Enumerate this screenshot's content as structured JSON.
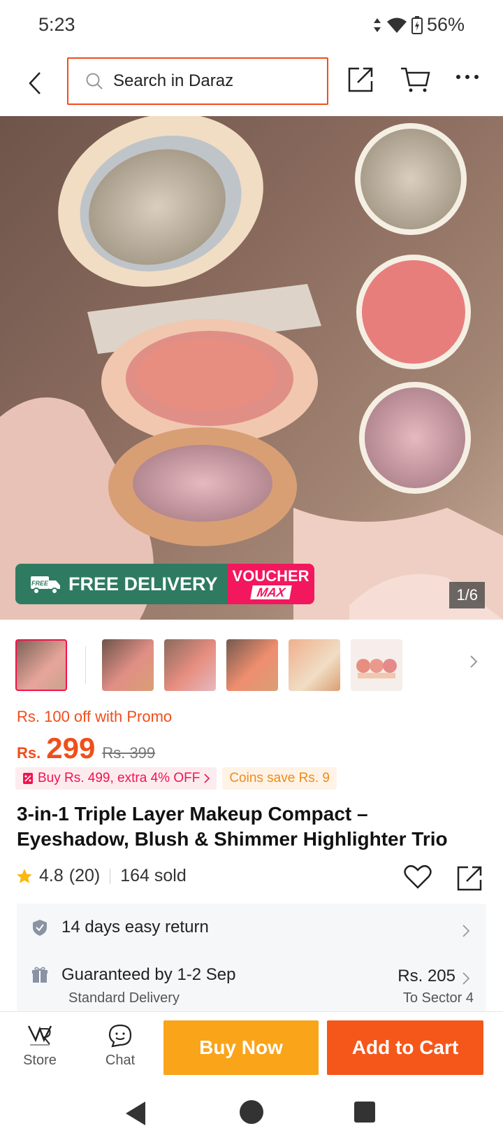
{
  "status": {
    "time": "5:23",
    "battery": "56%"
  },
  "search": {
    "placeholder": "Search in Daraz"
  },
  "hero": {
    "banner_free": "FREE DELIVERY",
    "banner_free_tag": "FREE",
    "banner_voucher": "VOUCHER",
    "banner_max": "MAX",
    "counter": "1/6"
  },
  "product": {
    "promo": "Rs. 100 off with Promo",
    "currency": "Rs.",
    "price": "299",
    "old_price": "Rs. 399",
    "chip_extra": "Buy Rs. 499, extra 4% OFF",
    "chip_coins": "Coins save Rs. 9",
    "title": "3-in-1 Triple Layer Makeup Compact – Eyeshadow, Blush & Shimmer Highlighter Trio",
    "rating": "4.8",
    "reviews": "(20)",
    "sold": "164 sold"
  },
  "services": {
    "return": "14 days easy return",
    "delivery": "Guaranteed by 1-2 Sep",
    "delivery_type": "Standard Delivery",
    "delivery_price": "Rs. 205",
    "delivery_to": "To Sector 4"
  },
  "bottom": {
    "store": "Store",
    "chat": "Chat",
    "buy_now": "Buy Now",
    "add_to_cart": "Add to Cart"
  },
  "colors": {
    "accent": "#f04e1b",
    "buy": "#faa41a",
    "cart": "#f5571a",
    "pink": "#f5114d"
  }
}
